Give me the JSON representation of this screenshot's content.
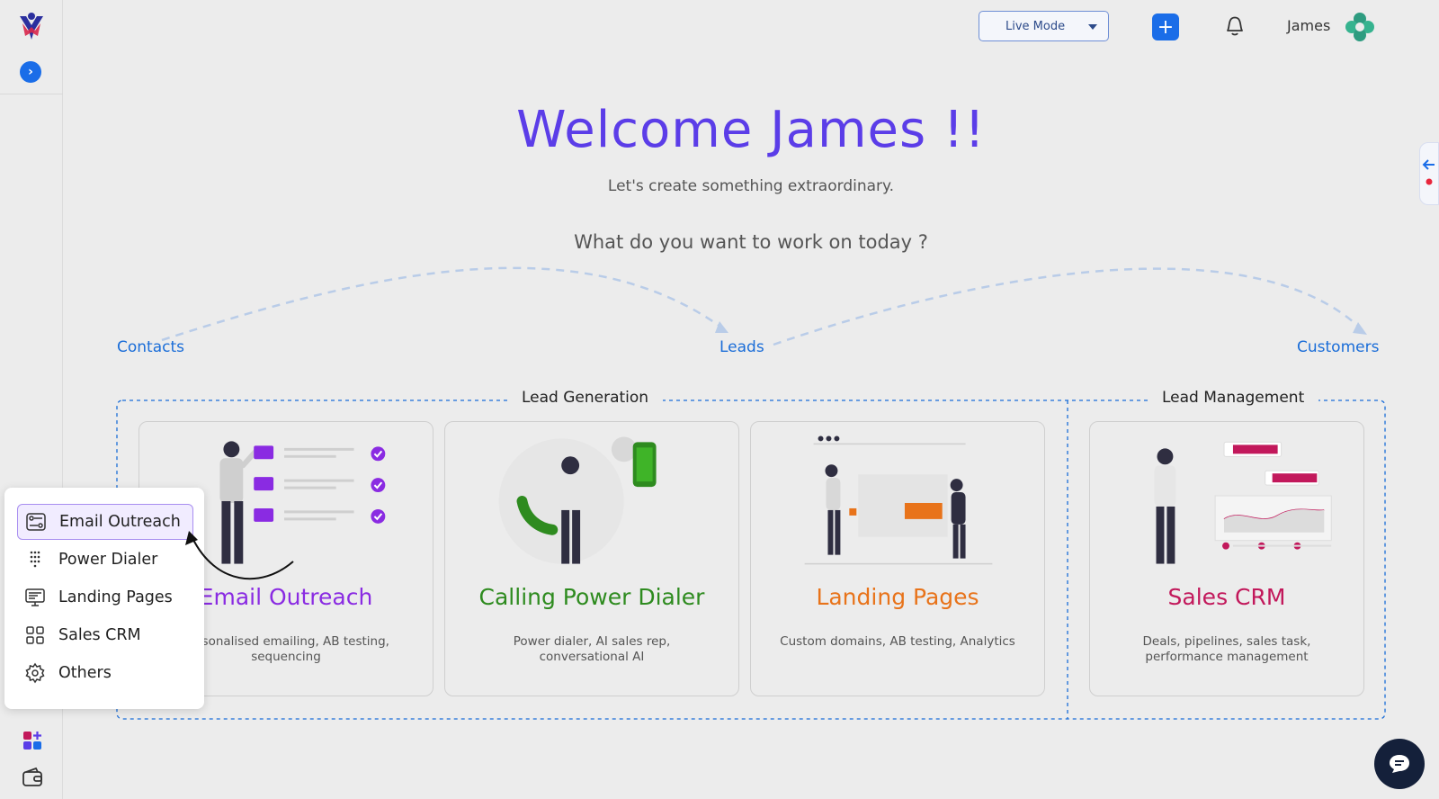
{
  "header": {
    "mode_label": "Live Mode",
    "user_name": "James"
  },
  "hero": {
    "welcome": "Welcome James !!",
    "tagline": "Let's create something extraordinary.",
    "question": "What do you want to work on today ?"
  },
  "flow": {
    "stages": [
      "Contacts",
      "Leads",
      "Customers"
    ]
  },
  "groups": {
    "lead_generation": "Lead Generation",
    "lead_management": "Lead Management"
  },
  "cards": [
    {
      "title": "Email Outreach",
      "desc": "Personalised emailing, AB testing, sequencing",
      "color": "#8a2be2"
    },
    {
      "title": "Calling Power Dialer",
      "desc": "Power dialer, AI sales rep, conversational AI",
      "color": "#2e8b1f"
    },
    {
      "title": "Landing Pages",
      "desc": "Custom domains, AB testing, Analytics",
      "color": "#e8731a"
    },
    {
      "title": "Sales CRM",
      "desc": "Deals, pipelines, sales task, performance management",
      "color": "#c2185b"
    }
  ],
  "menu": {
    "items": [
      {
        "label": "Email Outreach",
        "icon": "email-outreach-icon",
        "active": true
      },
      {
        "label": "Power Dialer",
        "icon": "power-dialer-icon"
      },
      {
        "label": "Landing Pages",
        "icon": "landing-pages-icon"
      },
      {
        "label": "Sales CRM",
        "icon": "sales-crm-icon"
      },
      {
        "label": "Others",
        "icon": "gear-icon"
      }
    ]
  },
  "colors": {
    "brand": "#5b3de8",
    "accent_blue": "#1a6de8",
    "link": "#1a6dd8"
  }
}
